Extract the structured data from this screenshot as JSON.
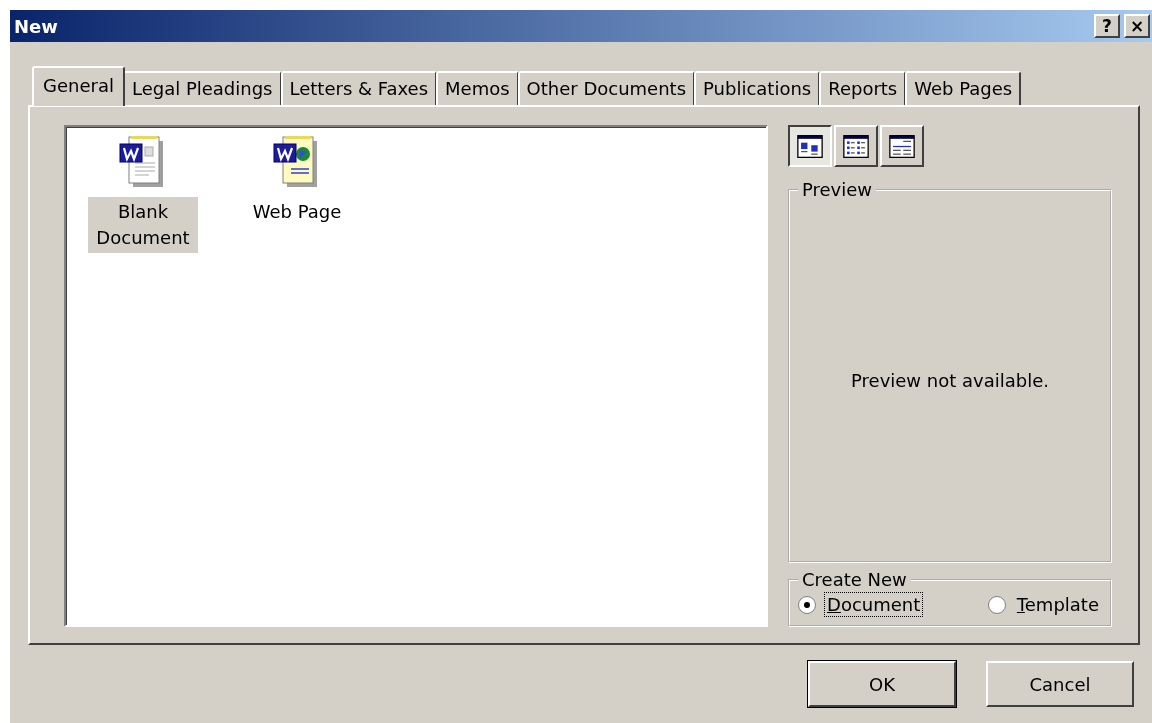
{
  "window": {
    "title": "New"
  },
  "title_buttons": [
    {
      "label": "?",
      "kind": "help"
    },
    {
      "label": "×",
      "kind": "close"
    }
  ],
  "tabs": [
    {
      "label": "General",
      "selected": true
    },
    {
      "label": "Legal Pleadings",
      "selected": false
    },
    {
      "label": "Letters & Faxes",
      "selected": false
    },
    {
      "label": "Memos",
      "selected": false
    },
    {
      "label": "Other Documents",
      "selected": false
    },
    {
      "label": "Publications",
      "selected": false
    },
    {
      "label": "Reports",
      "selected": false
    },
    {
      "label": "Web Pages",
      "selected": false
    }
  ],
  "templates": [
    {
      "label": "Blank Document",
      "kind": "document",
      "selected": true
    },
    {
      "label": "Web Page",
      "kind": "web",
      "selected": false
    }
  ],
  "view_buttons": [
    {
      "kind": "large-icons",
      "selected": true
    },
    {
      "kind": "list",
      "selected": false
    },
    {
      "kind": "details",
      "selected": false
    }
  ],
  "preview": {
    "title": "Preview",
    "message": "Preview not available."
  },
  "create_new": {
    "title": "Create New",
    "options": [
      {
        "label": "Document",
        "selected": true,
        "focused": true
      },
      {
        "label": "Template",
        "selected": false,
        "focused": false
      }
    ]
  },
  "buttons": [
    {
      "label": "OK",
      "default": true
    },
    {
      "label": "Cancel",
      "default": false
    }
  ]
}
